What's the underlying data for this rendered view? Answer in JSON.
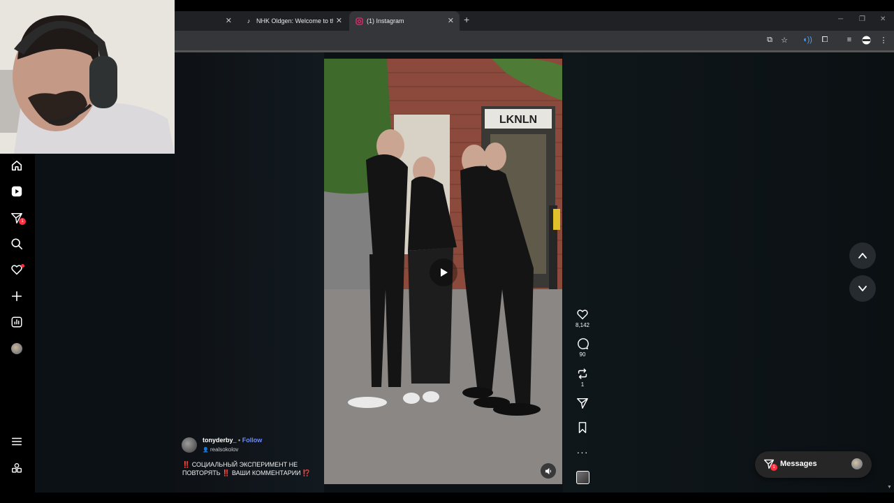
{
  "browser": {
    "tabs": [
      {
        "title": "",
        "active": false
      },
      {
        "title": "NHK Oldgen: Welcome to the N",
        "active": false,
        "icon": "tiktok-icon"
      },
      {
        "title": "(1) Instagram",
        "active": true,
        "icon": "instagram-icon"
      }
    ],
    "new_tab_label": "+"
  },
  "sidebar": {
    "items": [
      {
        "name": "home",
        "icon": "home-icon"
      },
      {
        "name": "reels",
        "icon": "reels-icon"
      },
      {
        "name": "messages",
        "icon": "send-icon",
        "badge": "1"
      },
      {
        "name": "search",
        "icon": "search-icon"
      },
      {
        "name": "notifications",
        "icon": "heart-icon"
      },
      {
        "name": "create",
        "icon": "plus-icon"
      },
      {
        "name": "insights",
        "icon": "chart-icon"
      },
      {
        "name": "profile",
        "icon": "avatar"
      }
    ],
    "bottom_items": [
      {
        "name": "more",
        "icon": "menu-icon"
      },
      {
        "name": "also-from-meta",
        "icon": "grid-icon"
      }
    ]
  },
  "reel": {
    "author": "tonyderby_",
    "separator": "•",
    "follow_label": "Follow",
    "audio": "realsokolov",
    "caption_mark_1": "‼️",
    "caption_part_1": "СОЦИАЛЬНЫЙ ЭКСПЕРИМЕНТ НЕ ПОВТОРЯТЬ",
    "caption_mark_2": "‼️",
    "caption_part_2": "ВАШИ КОММЕНТАРИИ",
    "caption_mark_3": "⁉️",
    "storefront_sign": "LKNLN"
  },
  "actions": {
    "likes": "8,142",
    "comments": "90",
    "reposts": "1"
  },
  "messages_dock": {
    "label": "Messages",
    "badge": "1"
  },
  "colors": {
    "page_bg": "#0c1115",
    "follow_blue": "#6f8cff",
    "badge_red": "#ff3040"
  }
}
